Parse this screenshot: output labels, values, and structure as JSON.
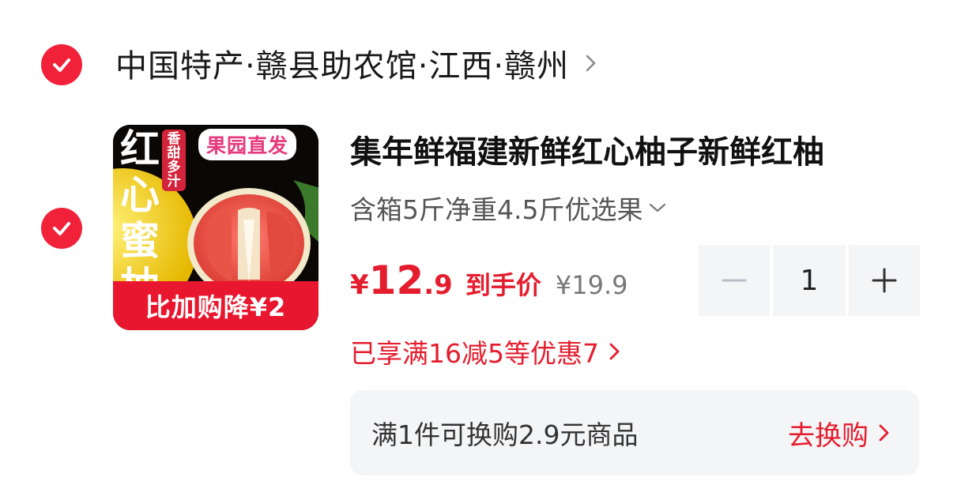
{
  "colors": {
    "accent": "#e41d2e",
    "check": "#f2213a",
    "stepper_bg": "#f4f5f7",
    "banner_bg": "#e8162e"
  },
  "store": {
    "name": "中国特产·赣县助农馆·江西·赣州",
    "checked": true,
    "arrow_icon": "chevron-right-icon"
  },
  "item": {
    "checked": true,
    "thumbnail": {
      "vertical_text": "红心蜜柚",
      "sweet_label": "香甜多汁",
      "tag": "果园直发",
      "banner": "比加购降¥2"
    },
    "title": "集年鲜福建新鲜红心柚子新鲜红柚",
    "spec": "含箱5斤净重4.5斤优选果",
    "spec_icon": "chevron-down-icon",
    "price": {
      "currency": "¥",
      "integer": "12",
      "decimal": ".9",
      "label": "到手价",
      "original": "¥19.9"
    },
    "quantity": "1",
    "promo": "已享满16减5等优惠7",
    "tradeup": {
      "text": "满1件可换购2.9元商品",
      "action": "去换购"
    }
  }
}
